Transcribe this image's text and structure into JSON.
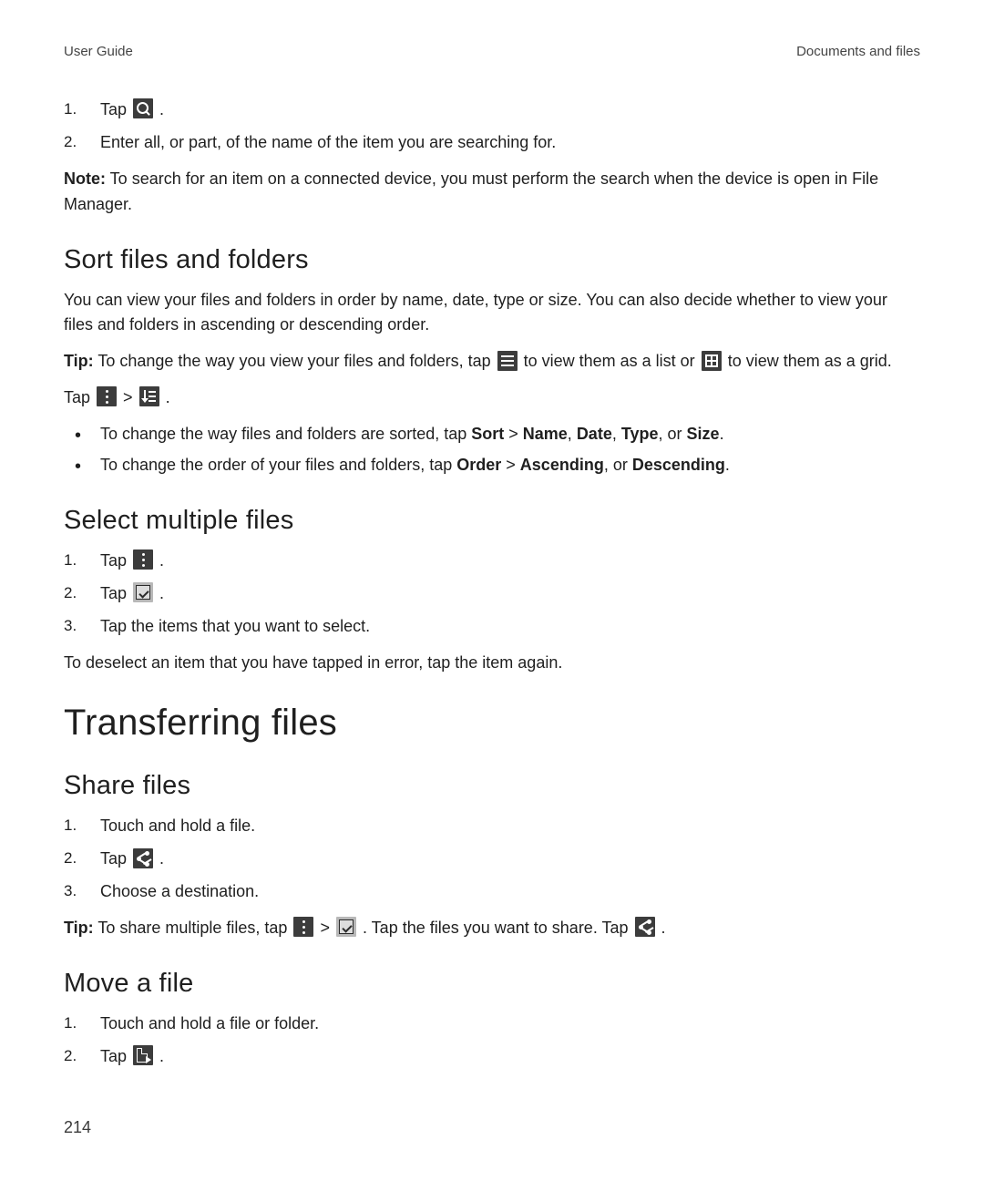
{
  "header": {
    "left": "User Guide",
    "right": "Documents and files"
  },
  "search": {
    "steps": [
      {
        "prefix": "Tap ",
        "icon": "search",
        "suffix": " ."
      },
      {
        "text": "Enter all, or part, of the name of the item you are searching for."
      }
    ],
    "note_label": "Note:",
    "note_text": " To search for an item on a connected device, you must perform the search when the device is open in File Manager."
  },
  "sort": {
    "heading": "Sort files and folders",
    "intro": "You can view your files and folders in order by name, date, type or size. You can also decide whether to view your files and folders in ascending or descending order.",
    "tip_label": "Tip:",
    "tip_p1": " To change the way you view your files and folders, tap ",
    "tip_mid": " to view them as a list or ",
    "tip_end": " to view them as a grid.",
    "tap_label": "Tap ",
    "sep": "  >  ",
    "period": " .",
    "bullets": [
      {
        "t1": "To change the way files and folders are sorted, tap ",
        "b1": "Sort",
        "sep": " > ",
        "b2": "Name",
        "c": ", ",
        "b3": "Date",
        "b4": "Type",
        "or": ", or ",
        "b5": "Size",
        "end": "."
      },
      {
        "t1": "To change the order of your files and folders, tap ",
        "b1": "Order",
        "sep": " > ",
        "b2": "Ascending",
        "or": ", or ",
        "b3": "Descending",
        "end": "."
      }
    ]
  },
  "select": {
    "heading": "Select multiple files",
    "steps": [
      {
        "prefix": "Tap ",
        "icon": "more"
      },
      {
        "prefix": "Tap ",
        "icon": "check"
      },
      {
        "text": "Tap the items that you want to select."
      }
    ],
    "after": "To deselect an item that you have tapped in error, tap the item again."
  },
  "transfer": {
    "heading": "Transferring files"
  },
  "share": {
    "heading": "Share files",
    "steps": [
      {
        "text": "Touch and hold a file."
      },
      {
        "prefix": "Tap ",
        "icon": "share"
      },
      {
        "text": "Choose a destination."
      }
    ],
    "tip_label": "Tip:",
    "tip_p1": " To share multiple files, tap ",
    "tip_mid": " . Tap the files you want to share. Tap ",
    "tip_end": " ."
  },
  "move": {
    "heading": "Move a file",
    "steps": [
      {
        "text": "Touch and hold a file or folder."
      },
      {
        "prefix": "Tap ",
        "icon": "move"
      }
    ]
  },
  "page_number": "214"
}
